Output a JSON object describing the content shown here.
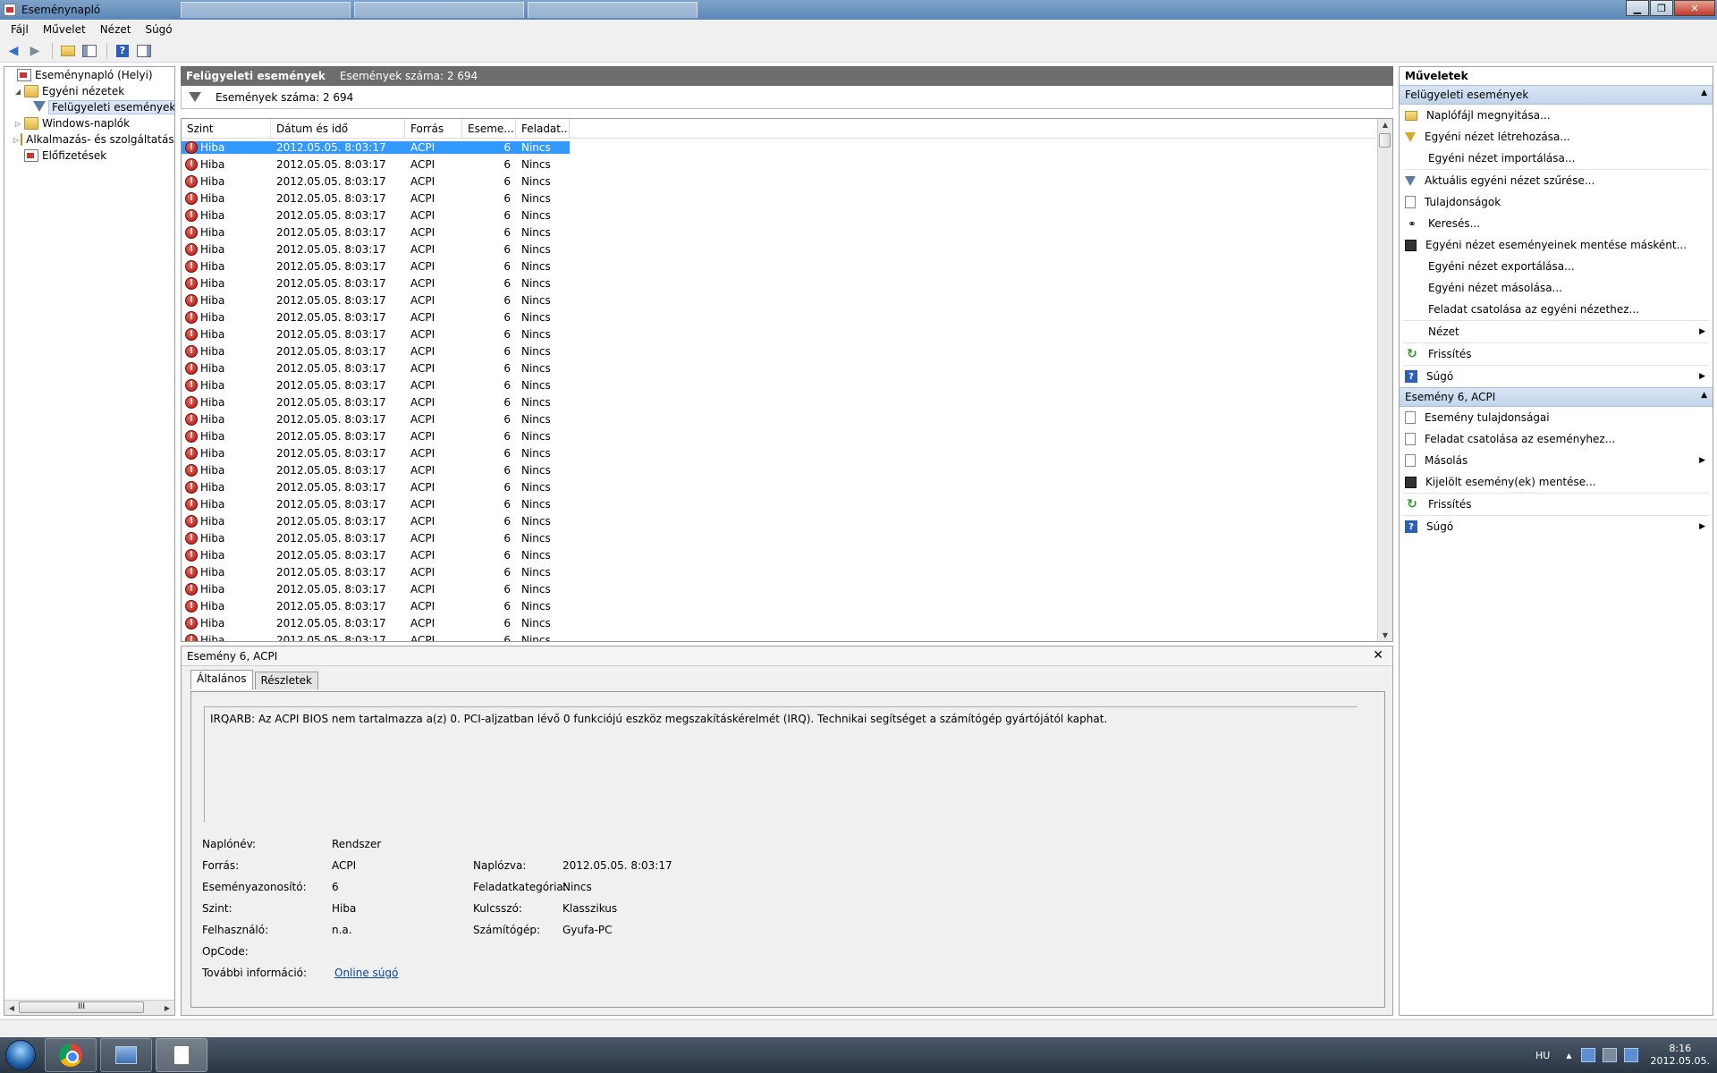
{
  "window": {
    "title": "Eseménynapló"
  },
  "menu": [
    "Fájl",
    "Művelet",
    "Nézet",
    "Súgó"
  ],
  "toolbar": {
    "icons": [
      "back-arrow-icon",
      "forward-arrow-icon",
      "folder-up-icon",
      "show-hide-tree-icon",
      "help-icon",
      "show-hide-action-pane-icon"
    ]
  },
  "tree": {
    "root": "Eseménynapló (Helyi)",
    "custom_views": "Egyéni nézetek",
    "admin_events": "Felügyeleti események",
    "windows_logs": "Windows-naplók",
    "app_logs": "Alkalmazás- és szolgáltatásn",
    "subscriptions": "Előfizetések",
    "scroll_thumb": "III"
  },
  "center": {
    "header_title": "Felügyeleti események",
    "header_count": "Események száma: 2 694",
    "filter_text": "Események száma: 2 694",
    "columns": [
      "Szint",
      "Dátum és idő",
      "Forrás",
      "Eseme...",
      "Feladat..."
    ],
    "row": {
      "level": "Hiba",
      "date": "2012.05.05. 8:03:17",
      "source": "ACPI",
      "id": "6",
      "task": "Nincs"
    }
  },
  "detail": {
    "title": "Esemény 6, ACPI",
    "close": "✕",
    "tabs": [
      "Általános",
      "Részletek"
    ],
    "message": "IRQARB: Az ACPI BIOS nem tartalmazza a(z) 0. PCI-aljzatban lévő 0 funkciójú eszköz megszakításkérelmét (IRQ). Technikai segítséget a számítógép gyártójától kaphat.",
    "fields": {
      "log_name_label": "Naplónév:",
      "log_name": "Rendszer",
      "source_label": "Forrás:",
      "source": "ACPI",
      "logged_label": "Naplózva:",
      "logged": "2012.05.05. 8:03:17",
      "event_id_label": "Eseményazonosító:",
      "event_id": "6",
      "task_cat_label": "Feladatkategória:",
      "task_cat": "Nincs",
      "level_label": "Szint:",
      "level": "Hiba",
      "keywords_label": "Kulcsszó:",
      "keywords": "Klasszikus",
      "user_label": "Felhasználó:",
      "user": "n.a.",
      "computer_label": "Számítógép:",
      "computer": "Gyufa-PC",
      "opcode_label": "OpCode:",
      "opcode": "",
      "more_info_label": "További információ:",
      "more_info_link": "Online súgó"
    }
  },
  "actions": {
    "title": "Műveletek",
    "section1": "Felügyeleti események",
    "section1_items": [
      "Naplófájl megnyitása...",
      "Egyéni nézet létrehozása...",
      "Egyéni nézet importálása...",
      "Aktuális egyéni nézet szűrése...",
      "Tulajdonságok",
      "Keresés...",
      "Egyéni nézet eseményeinek mentése másként...",
      "Egyéni nézet exportálása...",
      "Egyéni nézet másolása...",
      "Feladat csatolása az egyéni nézethez...",
      "Nézet",
      "Frissítés",
      "Súgó"
    ],
    "section2": "Esemény 6, ACPI",
    "section2_items": [
      "Esemény tulajdonságai",
      "Feladat csatolása az eseményhez...",
      "Másolás",
      "Kijelölt esemény(ek) mentése...",
      "Frissítés",
      "Súgó"
    ]
  },
  "taskbar": {
    "lang": "HU",
    "time": "8:16",
    "date": "2012.05.05."
  }
}
